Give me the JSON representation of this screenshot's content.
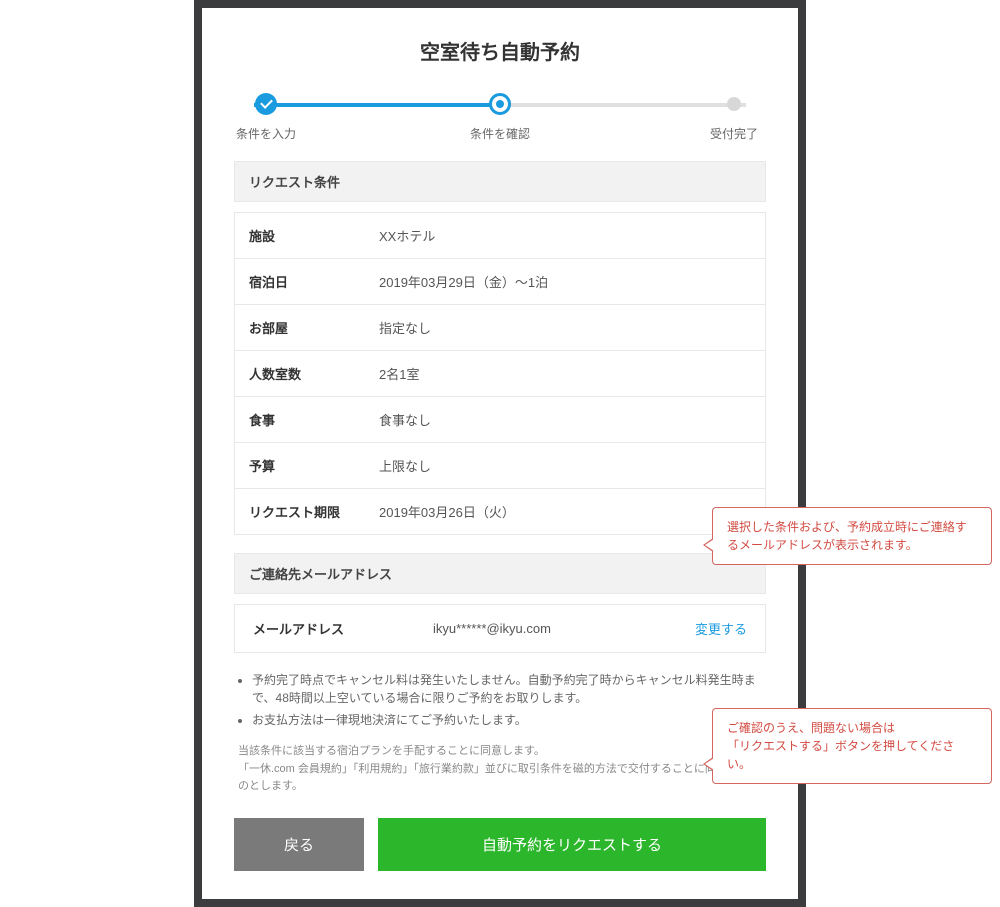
{
  "page_title": "空室待ち自動予約",
  "progress": {
    "steps": [
      {
        "label": "条件を入力",
        "state": "done"
      },
      {
        "label": "条件を確認",
        "state": "current"
      },
      {
        "label": "受付完了",
        "state": "pending"
      }
    ]
  },
  "request_conditions": {
    "header": "リクエスト条件",
    "rows": [
      {
        "label": "施設",
        "value": "XXホテル"
      },
      {
        "label": "宿泊日",
        "value": "2019年03月29日（金）〜1泊"
      },
      {
        "label": "お部屋",
        "value": "指定なし"
      },
      {
        "label": "人数室数",
        "value": "2名1室"
      },
      {
        "label": "食事",
        "value": "食事なし"
      },
      {
        "label": "予算",
        "value": "上限なし"
      },
      {
        "label": "リクエスト期限",
        "value": "2019年03月26日（火）"
      }
    ]
  },
  "contact_email": {
    "header": "ご連絡先メールアドレス",
    "label": "メールアドレス",
    "value": "ikyu******@ikyu.com",
    "change_label": "変更する"
  },
  "notes": [
    "予約完了時点でキャンセル料は発生いたしません。自動予約完了時からキャンセル料発生時まで、48時間以上空いている場合に限りご予約をお取りします。",
    "お支払方法は一律現地決済にてご予約いたします。"
  ],
  "agreement": {
    "line1": "当該条件に該当する宿泊プランを手配することに同意します。",
    "line2": "「一休.com 会員規約」「利用規約」「旅行業約款」並びに取引条件を磁的方法で交付することに同意するものとします。"
  },
  "buttons": {
    "back": "戻る",
    "submit": "自動予約をリクエストする"
  },
  "callouts": {
    "c1": "選択した条件および、予約成立時にご連絡するメールアドレスが表示されます。",
    "c2_line1": "ご確認のうえ、問題ない場合は",
    "c2_line2": "「リクエストする」ボタンを押してください。"
  }
}
